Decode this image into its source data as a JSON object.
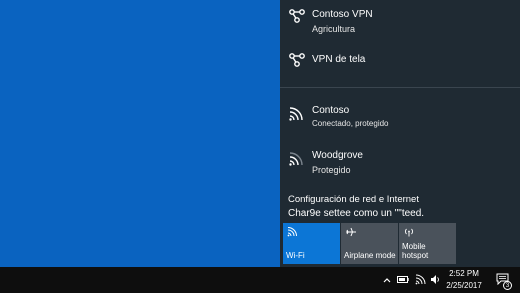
{
  "vpn_connections": [
    {
      "name": "Contoso VPN",
      "subtitle": "Agricultura",
      "icon": "vpn-icon"
    },
    {
      "name": "VPN de tela",
      "icon": "vpn-icon"
    }
  ],
  "wifi_networks": [
    {
      "name": "Contoso",
      "status": "Conectado, protegido",
      "icon": "wifi-signal-icon"
    },
    {
      "name": "Woodgrove",
      "status": "Protegido",
      "icon": "wifi-signal-icon"
    }
  ],
  "settings_link": "Configuración de red e Internet",
  "status_line": "Char9e settee como un \"\"teed.",
  "quick_actions": [
    {
      "label": "Wi-Fi",
      "active": true,
      "icon": "wifi-icon",
      "color": "#0c76d6"
    },
    {
      "label": "Airplane mode",
      "active": false,
      "icon": "airplane-icon",
      "color": "#4a525b"
    },
    {
      "label": "Mobile\nhotspot",
      "active": false,
      "icon": "hotspot-icon",
      "color": "#4a525b"
    }
  ],
  "taskbar": {
    "time": "2:52 PM",
    "date": "2/25/2017",
    "notification_count": "3"
  },
  "colors": {
    "desktop": "#0a63c0",
    "flyout": "#1f2a33",
    "accent": "#0c76d6",
    "taskbar": "#0e0e0e"
  }
}
